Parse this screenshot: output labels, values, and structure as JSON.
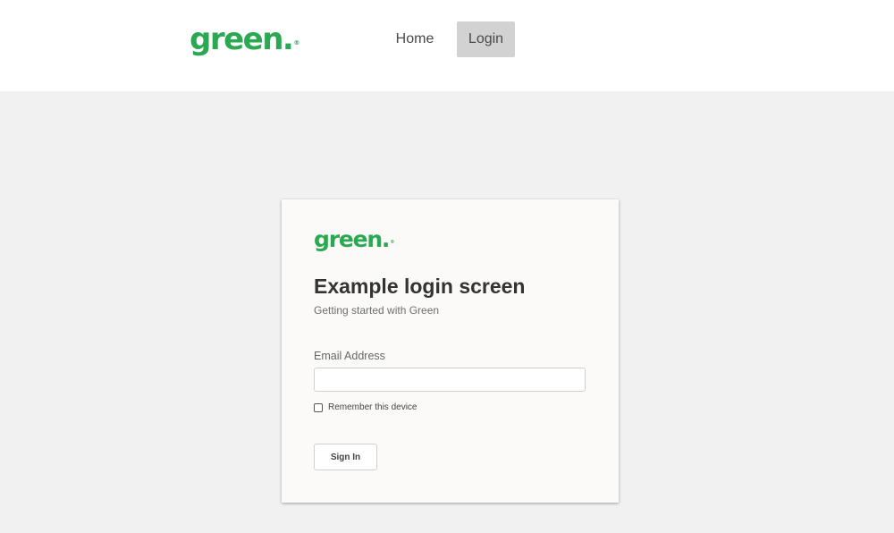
{
  "header": {
    "logo_text": "green.",
    "logo_mark": "®",
    "nav": {
      "home": "Home",
      "login": "Login"
    }
  },
  "card": {
    "logo_text": "green.",
    "logo_mark": "®",
    "title": "Example login screen",
    "subtitle": "Getting started with Green",
    "email_label": "Email Address",
    "email_value": "",
    "remember_label": "Remember this device",
    "remember_checked": false,
    "signin_label": "Sign In"
  },
  "colors": {
    "brand_green": "#2aa852",
    "page_background": "#f1f1f1",
    "card_background": "#fcfaf9",
    "active_nav_background": "#d2d2d2"
  }
}
